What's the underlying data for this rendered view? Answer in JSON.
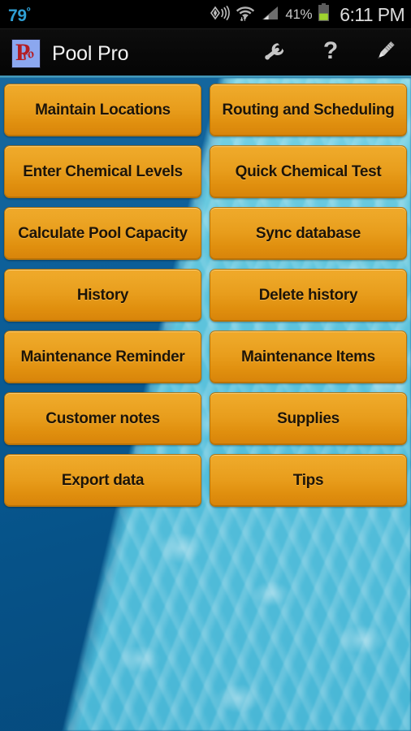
{
  "status_bar": {
    "temperature": "79",
    "degree_symbol": "º",
    "battery_percent": "41%",
    "time": "6:11 PM",
    "icons": [
      "gps-location-icon",
      "wifi-data-transfer-icon",
      "cellular-signal-icon",
      "battery-icon"
    ]
  },
  "action_bar": {
    "logo_letter": "P",
    "logo_suffix": "ro",
    "title": "Pool Pro",
    "actions": [
      {
        "name": "wrench-icon",
        "label": "Settings"
      },
      {
        "name": "question-mark-icon",
        "label": "Help"
      },
      {
        "name": "pencil-icon",
        "label": "Edit"
      }
    ]
  },
  "menu": {
    "rows": [
      [
        {
          "label": "Maintain Locations"
        },
        {
          "label": "Routing and Scheduling"
        }
      ],
      [
        {
          "label": "Enter Chemical Levels"
        },
        {
          "label": "Quick Chemical Test"
        }
      ],
      [
        {
          "label": "Calculate Pool Capacity"
        },
        {
          "label": "Sync database"
        }
      ],
      [
        {
          "label": "History"
        },
        {
          "label": "Delete history"
        }
      ],
      [
        {
          "label": "Maintenance Reminder"
        },
        {
          "label": "Maintenance Items"
        }
      ],
      [
        {
          "label": "Customer notes"
        },
        {
          "label": "Supplies"
        }
      ],
      [
        {
          "label": "Export data"
        },
        {
          "label": "Tips"
        }
      ]
    ]
  },
  "colors": {
    "button_top": "#f0a92a",
    "button_bottom": "#d8840a",
    "button_border": "#b4740c",
    "button_text": "#1d1408",
    "status_temp": "#2f9fd4",
    "action_bar_bg": "#0a0a0a",
    "accent_divider": "#4ea7c8",
    "water_deep": "#0c5e98",
    "water_light": "#55bfdb",
    "battery_green": "#9fd32e",
    "logo_bg": "#8ba7ef",
    "logo_letter_color": "#b41c22"
  }
}
